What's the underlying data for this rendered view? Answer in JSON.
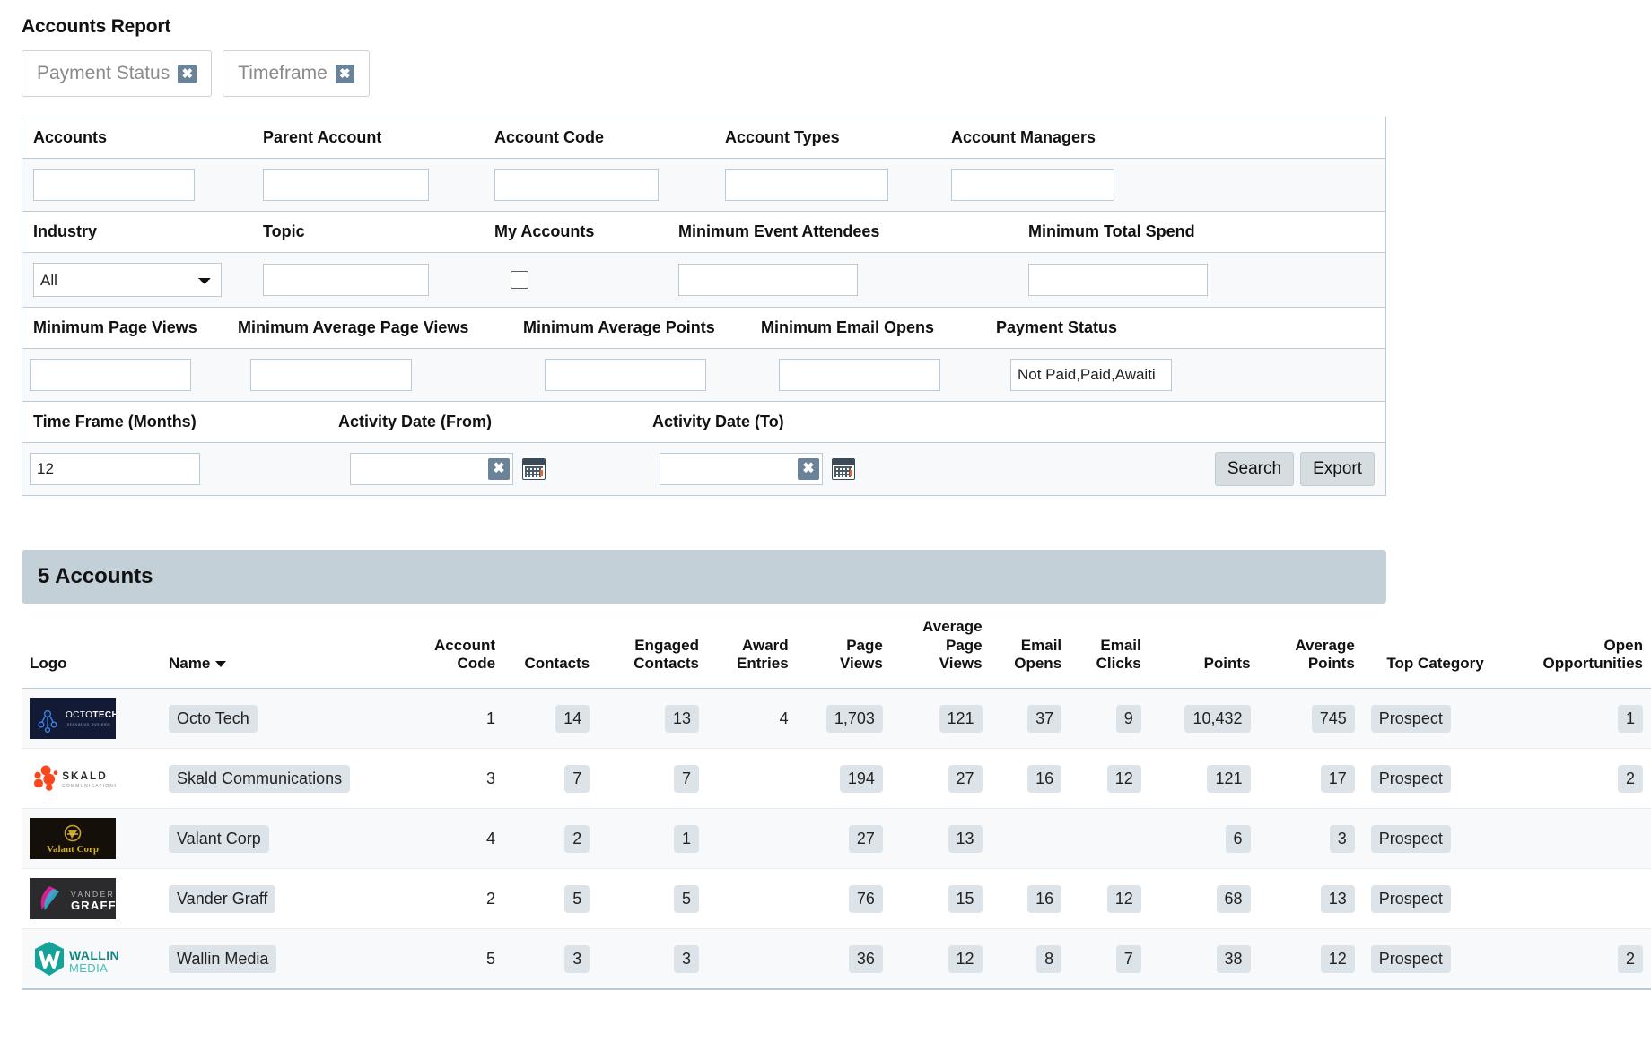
{
  "page": {
    "title": "Accounts Report"
  },
  "chips": [
    {
      "label": "Payment Status",
      "close": "✖"
    },
    {
      "label": "Timeframe",
      "close": "✖"
    }
  ],
  "filters": {
    "row1_labels": [
      "Accounts",
      "Parent Account",
      "Account Code",
      "Account Types",
      "Account Managers"
    ],
    "row1_values": [
      "",
      "",
      "",
      "",
      ""
    ],
    "row2_labels": [
      "Industry",
      "Topic",
      "My Accounts",
      "Minimum Event Attendees",
      "Minimum Total Spend"
    ],
    "industry_selected": "All",
    "industry_options": [
      "All"
    ],
    "topic_value": "",
    "my_accounts_checked": false,
    "min_event_attendees": "",
    "min_total_spend": "",
    "row3_labels": [
      "Minimum Page Views",
      "Minimum Average Page Views",
      "Minimum Average Points",
      "Minimum Email Opens",
      "Payment Status"
    ],
    "min_page_views": "",
    "min_avg_page_views": "",
    "min_avg_points": "",
    "min_email_opens": "",
    "payment_status_value": "Not Paid,Paid,Awaiti",
    "row4_labels": [
      "Time Frame (Months)",
      "Activity Date (From)",
      "Activity Date (To)"
    ],
    "time_frame_months": "12",
    "activity_date_from": "",
    "activity_date_to": "",
    "clear_glyph": "✖",
    "search_label": "Search",
    "export_label": "Export"
  },
  "results": {
    "count_label": "5 Accounts",
    "columns": [
      "Logo",
      "Name",
      "Account Code",
      "Contacts",
      "Engaged Contacts",
      "Award Entries",
      "Page Views",
      "Average Page Views",
      "Email Opens",
      "Email Clicks",
      "Points",
      "Average Points",
      "Top Category",
      "Open Opportunities"
    ],
    "sorted_column": "Name",
    "rows": [
      {
        "logo": "octo-tech-logo",
        "name": "Octo Tech",
        "account_code": "1",
        "contacts": "14",
        "engaged_contacts": "13",
        "award_entries": "4",
        "page_views": "1,703",
        "average_page_views": "121",
        "email_opens": "37",
        "email_clicks": "9",
        "points": "10,432",
        "average_points": "745",
        "top_category": "Prospect",
        "open_opportunities": "1"
      },
      {
        "logo": "skald-communications-logo",
        "name": "Skald Communications",
        "account_code": "3",
        "contacts": "7",
        "engaged_contacts": "7",
        "award_entries": "",
        "page_views": "194",
        "average_page_views": "27",
        "email_opens": "16",
        "email_clicks": "12",
        "points": "121",
        "average_points": "17",
        "top_category": "Prospect",
        "open_opportunities": "2"
      },
      {
        "logo": "valant-corp-logo",
        "name": "Valant Corp",
        "account_code": "4",
        "contacts": "2",
        "engaged_contacts": "1",
        "award_entries": "",
        "page_views": "27",
        "average_page_views": "13",
        "email_opens": "",
        "email_clicks": "",
        "points": "6",
        "average_points": "3",
        "top_category": "Prospect",
        "open_opportunities": ""
      },
      {
        "logo": "vander-graff-logo",
        "name": "Vander Graff",
        "account_code": "2",
        "contacts": "5",
        "engaged_contacts": "5",
        "award_entries": "",
        "page_views": "76",
        "average_page_views": "15",
        "email_opens": "16",
        "email_clicks": "12",
        "points": "68",
        "average_points": "13",
        "top_category": "Prospect",
        "open_opportunities": ""
      },
      {
        "logo": "wallin-media-logo",
        "name": "Wallin Media",
        "account_code": "5",
        "contacts": "3",
        "engaged_contacts": "3",
        "award_entries": "",
        "page_views": "36",
        "average_page_views": "12",
        "email_opens": "8",
        "email_clicks": "7",
        "points": "38",
        "average_points": "12",
        "top_category": "Prospect",
        "open_opportunities": "2"
      }
    ]
  },
  "colors": {
    "panel_border": "#b9cbd8",
    "results_bar": "#c4d0d8",
    "pill_bg": "#dde4e9",
    "chip_x_bg": "#6b8399",
    "row_alt": "#f7f9fa"
  }
}
